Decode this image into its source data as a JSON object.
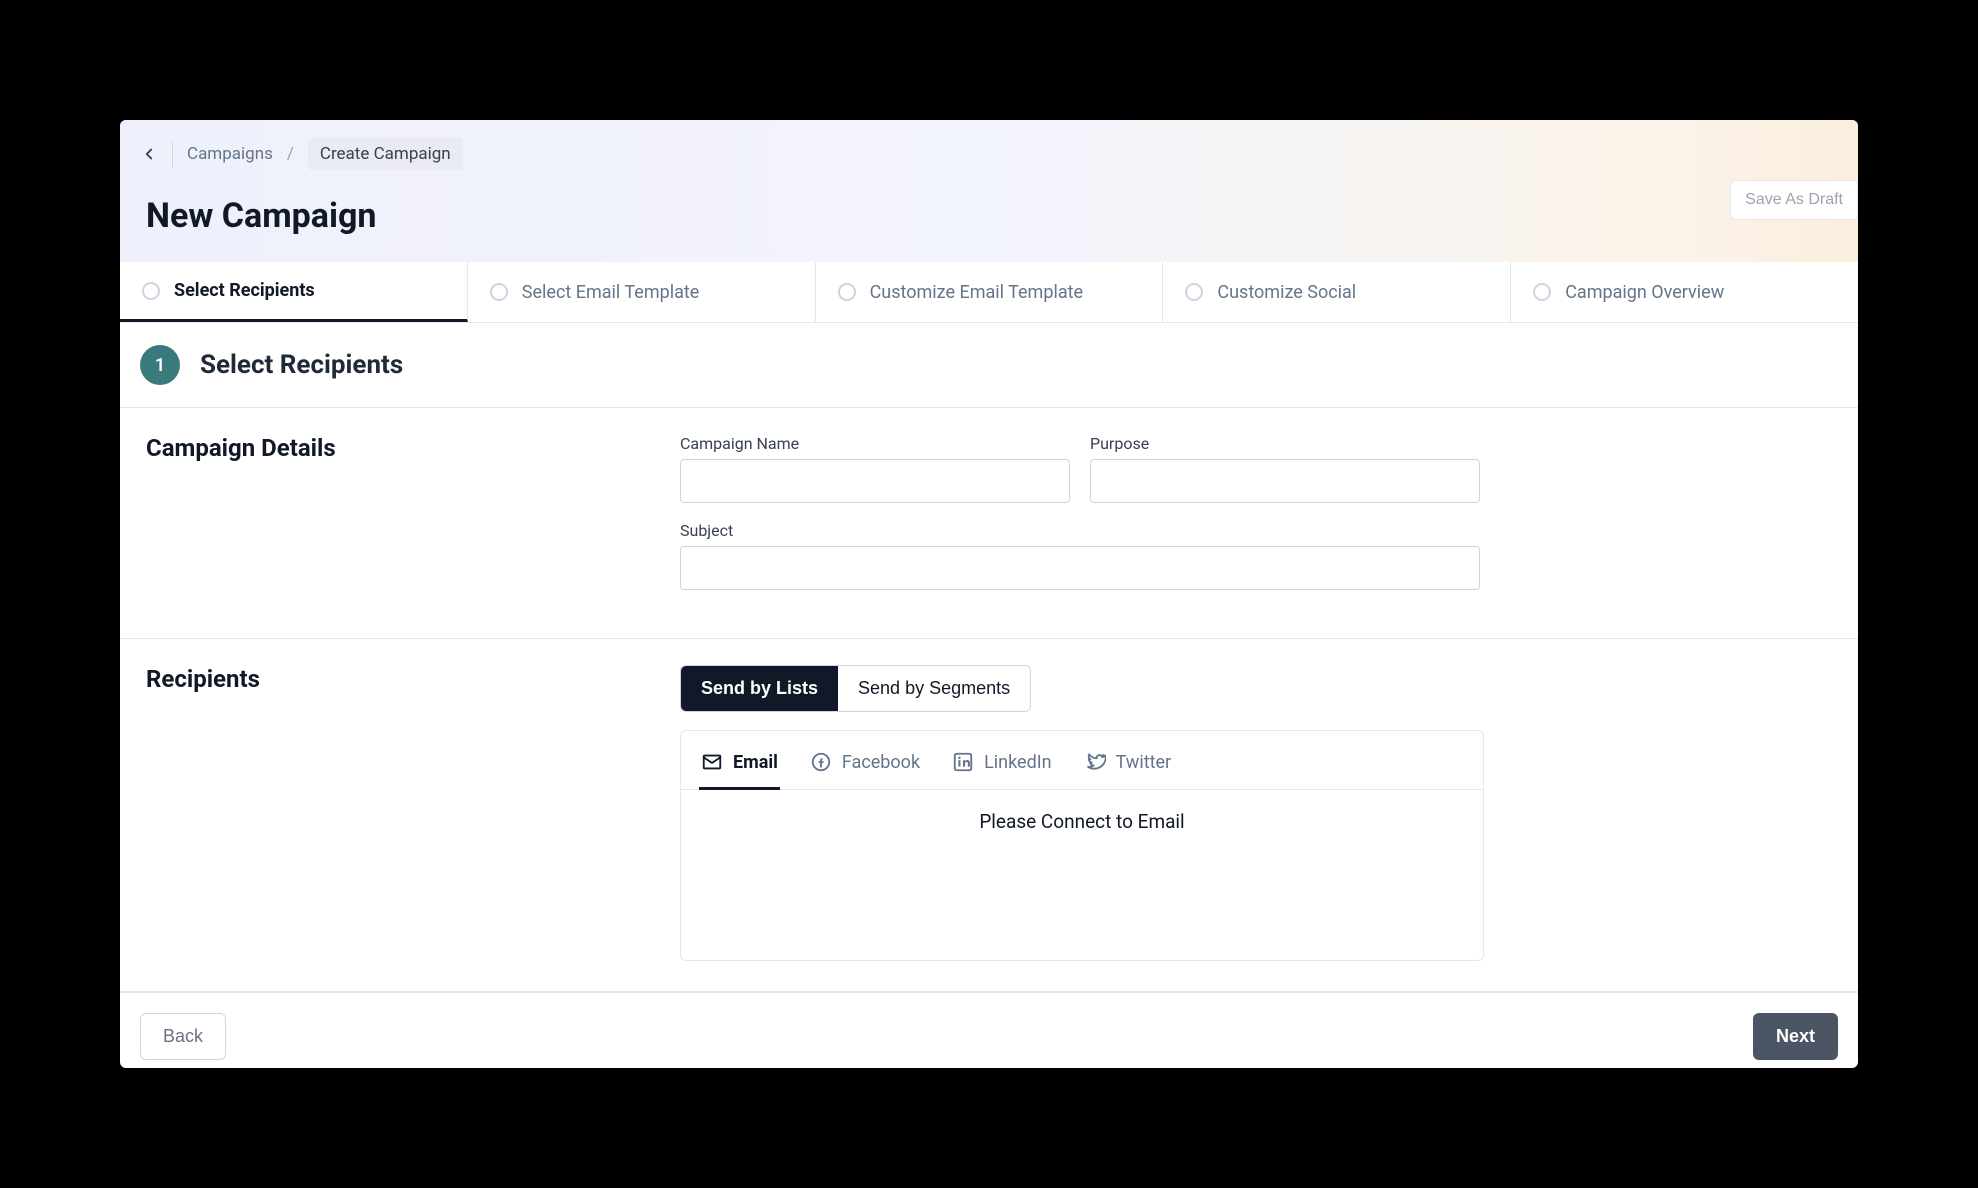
{
  "breadcrumb": {
    "parent": "Campaigns",
    "separator": "/",
    "current": "Create Campaign"
  },
  "page_title": "New Campaign",
  "header_actions": {
    "save_draft": "Save As Draft"
  },
  "stepper": {
    "steps": [
      {
        "label": "Select Recipients",
        "active": true
      },
      {
        "label": "Select Email Template",
        "active": false
      },
      {
        "label": "Customize Email Template",
        "active": false
      },
      {
        "label": "Customize Social",
        "active": false
      },
      {
        "label": "Campaign Overview",
        "active": false
      }
    ]
  },
  "current_step": {
    "number": "1",
    "title": "Select Recipients"
  },
  "sections": {
    "campaign_details": {
      "title": "Campaign Details",
      "fields": {
        "campaign_name": {
          "label": "Campaign Name",
          "value": ""
        },
        "purpose": {
          "label": "Purpose",
          "value": ""
        },
        "subject": {
          "label": "Subject",
          "value": ""
        }
      }
    },
    "recipients": {
      "title": "Recipients",
      "send_by": {
        "options": [
          {
            "label": "Send by Lists",
            "active": true
          },
          {
            "label": "Send by Segments",
            "active": false
          }
        ]
      },
      "channels": {
        "tabs": [
          {
            "label": "Email",
            "icon": "mail-icon",
            "active": true
          },
          {
            "label": "Facebook",
            "icon": "facebook-icon",
            "active": false
          },
          {
            "label": "LinkedIn",
            "icon": "linkedin-icon",
            "active": false
          },
          {
            "label": "Twitter",
            "icon": "twitter-icon",
            "active": false
          }
        ],
        "empty_message": "Please Connect to Email"
      }
    }
  },
  "footer": {
    "back": "Back",
    "next": "Next"
  }
}
